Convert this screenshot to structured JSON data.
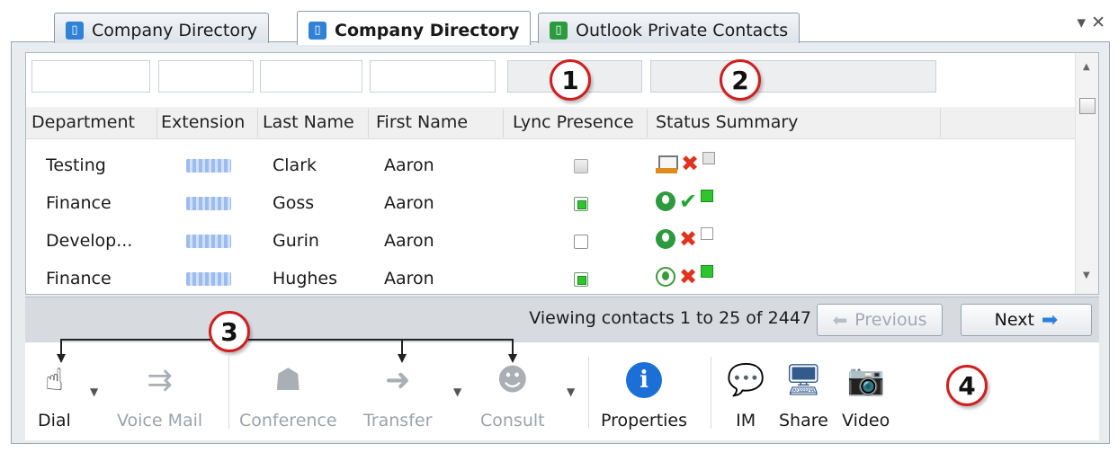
{
  "tabs": [
    {
      "label": "Company Directory",
      "icon": "directory-icon",
      "active": false
    },
    {
      "label": "Company Directory",
      "icon": "directory-icon",
      "active": true
    },
    {
      "label": "Outlook Private Contacts",
      "icon": "outlook-contacts-icon",
      "active": false
    }
  ],
  "tab_controls": {
    "menu": "▾",
    "close": "✕"
  },
  "columns": [
    "Department",
    "Extension",
    "Last Name",
    "First Name",
    "Lync Presence",
    "Status Summary"
  ],
  "rows": [
    {
      "department": "Testing",
      "last_name": "Clark",
      "first_name": "Aaron",
      "presence": "gray",
      "status": [
        "desk",
        "x",
        "gray"
      ]
    },
    {
      "department": "Finance",
      "last_name": "Goss",
      "first_name": "Aaron",
      "presence": "green",
      "status": [
        "person",
        "check",
        "green"
      ]
    },
    {
      "department": "Develop...",
      "last_name": "Gurin",
      "first_name": "Aaron",
      "presence": "empty",
      "status": [
        "person",
        "x",
        "empty"
      ]
    },
    {
      "department": "Finance",
      "last_name": "Hughes",
      "first_name": "Aaron",
      "presence": "green",
      "status": [
        "person-outline",
        "x",
        "green"
      ]
    }
  ],
  "pager": {
    "text": "Viewing contacts 1 to 25 of 2447",
    "previous": "Previous",
    "next": "Next"
  },
  "toolbar": {
    "dial": "Dial",
    "voice_mail": "Voice Mail",
    "conference": "Conference",
    "transfer": "Transfer",
    "consult": "Consult",
    "properties": "Properties",
    "im": "IM",
    "share": "Share",
    "video": "Video"
  },
  "callouts": [
    "1",
    "2",
    "3",
    "4"
  ],
  "colors": {
    "accent": "#2c7fe0",
    "presence_green": "#2fc52f",
    "callout_ring": "#d01f1f"
  }
}
